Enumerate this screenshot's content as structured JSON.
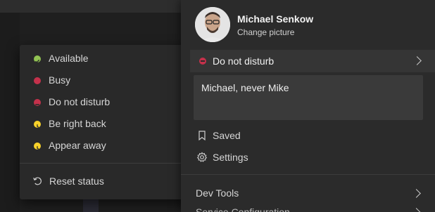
{
  "status_menu": {
    "items": [
      {
        "label": "Available",
        "color": "#92c353"
      },
      {
        "label": "Busy",
        "color": "#c4314b"
      },
      {
        "label": "Do not disturb",
        "color": "#c4314b"
      },
      {
        "label": "Be right back",
        "color": "#f8d22a"
      },
      {
        "label": "Appear away",
        "color": "#f8d22a"
      }
    ],
    "reset_label": "Reset status"
  },
  "profile": {
    "name": "Michael Senkow",
    "change_picture": "Change picture",
    "status_label": "Do not disturb",
    "status_message": "Michael, never Mike",
    "saved": "Saved",
    "settings": "Settings",
    "dev_tools": "Dev Tools",
    "cutoff_item": "Service Configuration"
  }
}
